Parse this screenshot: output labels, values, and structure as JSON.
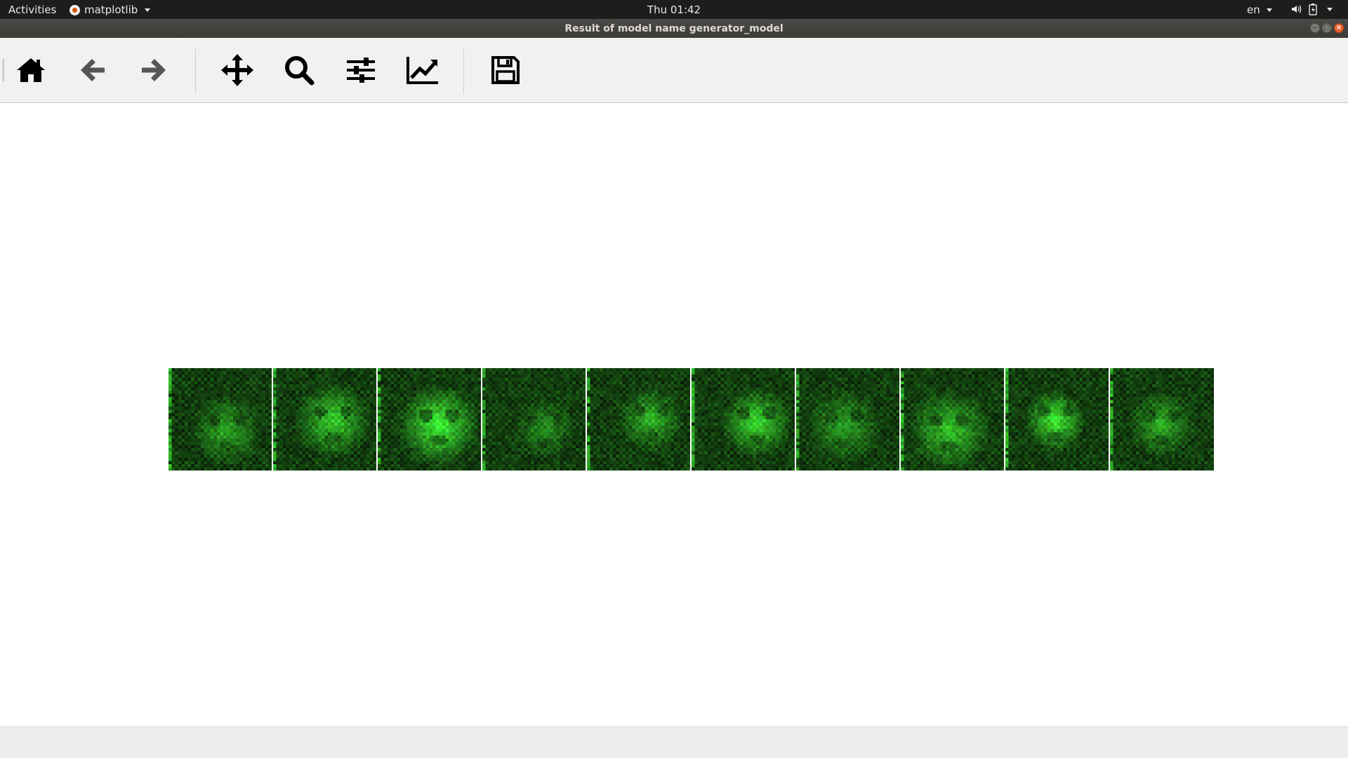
{
  "topbar": {
    "activities": "Activities",
    "app_name": "matplotlib",
    "clock": "Thu 01:42",
    "language": "en",
    "icons": [
      "volume-icon",
      "battery-icon",
      "system-menu-icon"
    ]
  },
  "window": {
    "title": "Result of model name generator_model",
    "buttons": [
      "minimize",
      "maximize",
      "close"
    ]
  },
  "toolbar": {
    "buttons": [
      {
        "name": "home",
        "icon": "home-icon"
      },
      {
        "name": "back",
        "icon": "arrow-left-icon"
      },
      {
        "name": "forward",
        "icon": "arrow-right-icon"
      },
      {
        "name": "pan",
        "icon": "move-arrows-icon"
      },
      {
        "name": "zoom",
        "icon": "magnifier-icon"
      },
      {
        "name": "subplots",
        "icon": "sliders-icon"
      },
      {
        "name": "edit-axes",
        "icon": "line-chart-icon"
      },
      {
        "name": "save",
        "icon": "floppy-disk-icon"
      }
    ]
  },
  "figure": {
    "image_count": 10,
    "palette": {
      "dark": "#0c160c",
      "mid": "#2f5a2a",
      "bright": "#5fd35a",
      "highlight": "#a6ff9c"
    }
  },
  "statusbar": {
    "message": ""
  }
}
